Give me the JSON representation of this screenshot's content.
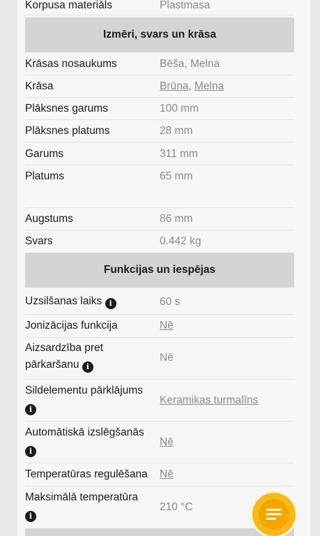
{
  "rows_top": [
    {
      "label": "Korpusa materiāls",
      "value": "Plastmasa"
    }
  ],
  "section1": {
    "title": "Izmēri, svars un krāsa"
  },
  "color_name": {
    "label": "Krāsas nosaukums",
    "value": "Bēša, Melna"
  },
  "color": {
    "label": "Krāsa",
    "link1": "Brūna",
    "sep": ", ",
    "link2": "Melna"
  },
  "plate_length": {
    "label": "Plāksnes garums",
    "value": "100 mm"
  },
  "plate_width": {
    "label": "Plāksnes platums",
    "value": "28 mm"
  },
  "length": {
    "label": "Garums",
    "value": "311 mm"
  },
  "width": {
    "label": "Platums",
    "value": "65 mm"
  },
  "height": {
    "label": "Augstums",
    "value": "86 mm"
  },
  "weight": {
    "label": "Svars",
    "value": "0.442 kg"
  },
  "section2": {
    "title": "Funkcijas un iespējas"
  },
  "heatup": {
    "label": "Uzsilšanas laiks",
    "value": "60 s"
  },
  "ionization": {
    "label": "Jonizācijas funkcija",
    "value": "Nē"
  },
  "overheat": {
    "label_line1": "Aizsardzība pret",
    "label_line2": "pārkaršanu",
    "value": "Nē"
  },
  "coating": {
    "label": "Sildelementu pārklājums",
    "value": "Keramikas turmalīns"
  },
  "autooff": {
    "label": "Automātiskā izslēgšanās",
    "value": "Nē"
  },
  "tempreg": {
    "label": "Temperatūras regulēšana",
    "value": "Nē"
  },
  "maxtemp": {
    "label": "Maksimālā temperatūra",
    "value": "210 °C"
  },
  "icons": {
    "info": "info-icon",
    "chat": "chat-icon"
  },
  "colors": {
    "accent": "#f7b81c",
    "section_bg": "#d4d4d4",
    "value_text": "#8a8a8a"
  }
}
